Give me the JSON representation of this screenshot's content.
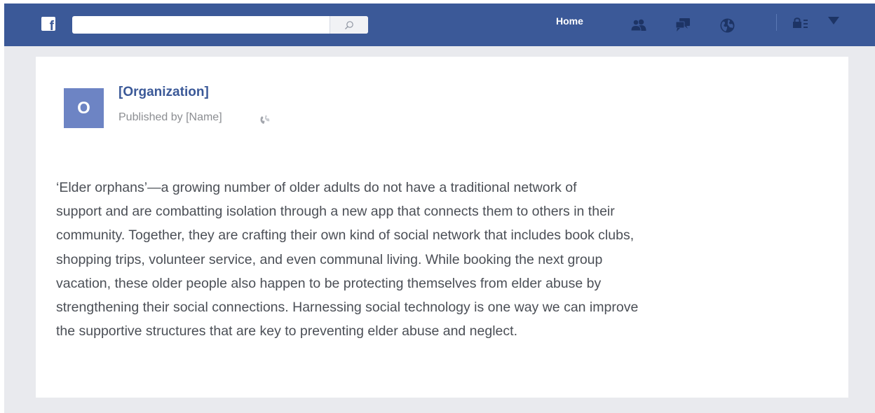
{
  "topbar": {
    "logo": "f",
    "search_placeholder": "",
    "search_icon": "search-icon",
    "home_label": "Home",
    "icons": [
      "friends-icon",
      "messages-icon",
      "notifications-globe-icon",
      "privacy-lock-icon",
      "account-dropdown-icon"
    ],
    "bg_color": "#3b5998"
  },
  "post": {
    "avatar_letter": "O",
    "organization": "[Organization]",
    "published_by": "Published by [Name]",
    "audience_icon": "globe-icon",
    "lines": [
      " ‘Elder orphans’—a growing number of older adults do not have a traditional network of",
      "support and are combatting isolation through a new app that connects them to others in their",
      "community. Together, they are crafting their own kind of social network that includes book clubs,",
      "shopping trips, volunteer service, and even communal living. While booking the next group",
      "vacation, these older people also happen to be protecting themselves from elder abuse by",
      "strengthening their social connections. Harnessing social technology is one way we can improve",
      "the supportive structures that are key to preventing elder abuse and neglect."
    ]
  },
  "colors": {
    "brand": "#3b5998",
    "avatar": "#6d84c4",
    "page_bg": "#e9eaee",
    "text": "#4b4f56",
    "muted": "#8c8e92"
  }
}
